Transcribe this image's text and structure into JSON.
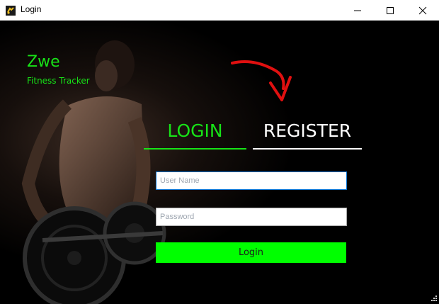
{
  "window": {
    "title": "Login",
    "icon": "dumbbell-app-icon",
    "controls": [
      "minimize-icon",
      "maximize-icon",
      "close-icon"
    ]
  },
  "brand": {
    "name": "Zwe",
    "subtitle": "Fitness Tracker"
  },
  "tabs": {
    "login_label": "LOGIN",
    "register_label": "REGISTER"
  },
  "form": {
    "username_placeholder": "User Name",
    "username_value": "",
    "password_placeholder": "Password",
    "password_value": "",
    "submit_label": "Login"
  },
  "colors": {
    "accent": "#17e317",
    "button": "#00ff00",
    "background": "#000000",
    "annotation_arrow": "#e01010"
  }
}
